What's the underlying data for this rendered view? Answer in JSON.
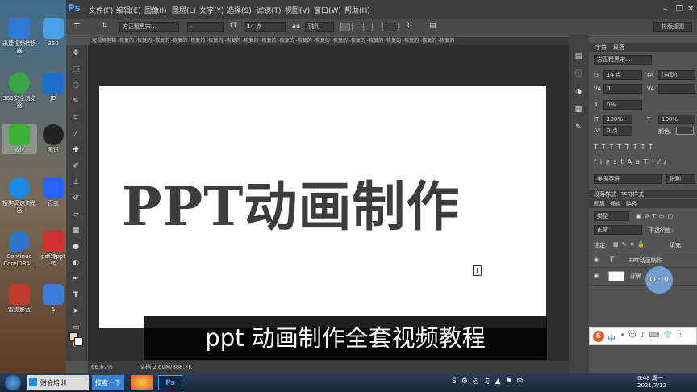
{
  "desktop": {
    "icons": [
      {
        "label": "迅捷视频转换器",
        "color": "#2d7bd6"
      },
      {
        "label": "360",
        "color": "#4aa0e6"
      },
      {
        "label": "360安全浏览器",
        "color": "#3aa64a"
      },
      {
        "label": "JD",
        "color": "#1f6fd1"
      },
      {
        "label": "微信",
        "color": "#3cb034"
      },
      {
        "label": "腾讯",
        "color": "#222222"
      },
      {
        "label": "搜狗高速浏览器",
        "color": "#1e88e5"
      },
      {
        "label": "百度",
        "color": "#2962ff"
      },
      {
        "label": "Continue CorelDRA...",
        "color": "#2f74c9"
      },
      {
        "label": "pdf转ppt转",
        "color": "#d32f2f"
      },
      {
        "label": "雷虎影音",
        "color": "#c0392b"
      },
      {
        "label": "A",
        "color": "#3b7dd8"
      }
    ]
  },
  "ps": {
    "logo": "Ps",
    "menus": [
      "文件(F)",
      "编辑(E)",
      "图像(I)",
      "图层(L)",
      "文字(Y)",
      "选择(S)",
      "滤镜(T)",
      "视图(V)",
      "窗口(W)",
      "帮助(H)"
    ],
    "options": {
      "font_family": "方正粗黑宋...",
      "font_style": "-",
      "font_size": "14 点",
      "antialias_label": "aɑ",
      "antialias": "锐利",
      "workspace_button": "排版规则"
    },
    "document_tab": "短视频剪辑 -恢复的 -恢复的 -恢复的 -恢复的 -恢复的 -恢复的 -恢复的 -恢复的 -恢复的 -恢复的 -恢复的 -恢复的 -恢复的 -恢复的 -恢复的 -恢复的 -恢复的 -恢复的 -恢复的",
    "canvas_text": "PPT动画制作",
    "status": {
      "zoom": "66.67%",
      "doc": "文档:2.60M/888.7K"
    },
    "char_panel": {
      "tabs": [
        "字符",
        "段落"
      ],
      "font": "方正粗黑宋...",
      "size": "14 点",
      "leading": "(自动)",
      "kerning": "0",
      "tracking": "0%",
      "vscale": "100%",
      "hscale": "100%",
      "baseline": "0 点",
      "color_label": "颜色:",
      "language": "美国英语",
      "aa": "锐利"
    },
    "para_tabs": [
      "段落样式",
      "字符样式"
    ],
    "layers": {
      "tabs": [
        "图层",
        "通道",
        "路径"
      ],
      "filter": "类型",
      "mode": "正常",
      "opacity_label": "不透明度:",
      "lock_label": "锁定:",
      "fill_label": "填充:",
      "items": [
        {
          "name": "PPT动画制作",
          "type": "T"
        },
        {
          "name": "背景"
        }
      ],
      "timer": "00:10"
    }
  },
  "subtitle": "ppt 动画制作全套视频教程",
  "taskbar": {
    "items": [
      "财会培训",
      "搜索一下"
    ],
    "time": "6:48 周一",
    "date": "2021/7/12",
    "ime": "中"
  }
}
